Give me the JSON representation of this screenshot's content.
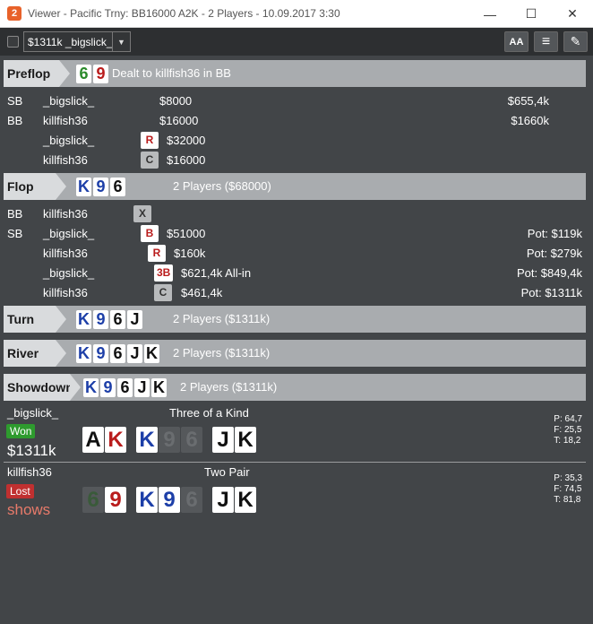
{
  "window": {
    "app_icon_text": "2",
    "title": "Viewer - Pacific Trny: BB16000 A2K - 2 Players - 10.09.2017 3:30",
    "minimize": "—",
    "maximize": "☐",
    "close": "✕"
  },
  "toolbar": {
    "player_select": "$1311k _bigslick_",
    "arrow": "▼",
    "font_btn": "AA",
    "list_btn": "≡",
    "edit_btn": "✎"
  },
  "preflop": {
    "label": "Preflop",
    "info": "Dealt to killfish36 in BB",
    "cards": [
      {
        "r": "6",
        "c": "green"
      },
      {
        "r": "9",
        "c": "red"
      }
    ],
    "rows": [
      {
        "pos": "SB",
        "player": "_bigslick_",
        "action": "",
        "amount": "$8000",
        "pot": "$655,4k"
      },
      {
        "pos": "BB",
        "player": "killfish36",
        "action": "",
        "amount": "$16000",
        "pot": "$1660k"
      },
      {
        "pos": "",
        "player": "_bigslick_",
        "action": "R",
        "amount": "$32000",
        "pot": ""
      },
      {
        "pos": "",
        "player": "killfish36",
        "action": "C",
        "amount": "$16000",
        "pot": ""
      }
    ]
  },
  "flop": {
    "label": "Flop",
    "info": "2 Players ($68000)",
    "cards": [
      {
        "r": "K",
        "c": "blue"
      },
      {
        "r": "9",
        "c": "blue"
      },
      {
        "r": "6",
        "c": "black"
      }
    ],
    "rows": [
      {
        "pos": "BB",
        "player": "killfish36",
        "action": "X",
        "amount": "",
        "pot": ""
      },
      {
        "pos": "SB",
        "player": "_bigslick_",
        "action": "B",
        "amount": "$51000",
        "pot": "Pot: $119k"
      },
      {
        "pos": "",
        "player": "killfish36",
        "action": "R",
        "amount": "$160k",
        "pot": "Pot: $279k"
      },
      {
        "pos": "",
        "player": "_bigslick_",
        "action": "3B",
        "amount": "$621,4k All-in",
        "pot": "Pot: $849,4k"
      },
      {
        "pos": "",
        "player": "killfish36",
        "action": "C",
        "amount": "$461,4k",
        "pot": "Pot: $1311k"
      }
    ]
  },
  "turn": {
    "label": "Turn",
    "info": "2 Players ($1311k)",
    "cards": [
      {
        "r": "K",
        "c": "blue"
      },
      {
        "r": "9",
        "c": "blue"
      },
      {
        "r": "6",
        "c": "black"
      },
      {
        "r": "J",
        "c": "black"
      }
    ]
  },
  "river": {
    "label": "River",
    "info": "2 Players ($1311k)",
    "cards": [
      {
        "r": "K",
        "c": "blue"
      },
      {
        "r": "9",
        "c": "blue"
      },
      {
        "r": "6",
        "c": "black"
      },
      {
        "r": "J",
        "c": "black"
      },
      {
        "r": "K",
        "c": "black"
      }
    ]
  },
  "showdown": {
    "label": "Showdown",
    "info": "2 Players ($1311k)",
    "cards": [
      {
        "r": "K",
        "c": "blue"
      },
      {
        "r": "9",
        "c": "blue"
      },
      {
        "r": "6",
        "c": "black"
      },
      {
        "r": "J",
        "c": "black"
      },
      {
        "r": "K",
        "c": "black"
      }
    ],
    "players": [
      {
        "name": "_bigslick_",
        "hand": "Three of a Kind",
        "result": "Won",
        "amount": "$1311k",
        "hole": [
          {
            "r": "A",
            "c": "black",
            "dim": false
          },
          {
            "r": "K",
            "c": "red",
            "dim": false
          }
        ],
        "board": [
          {
            "r": "K",
            "c": "blue",
            "dim": false
          },
          {
            "r": "9",
            "c": "blue",
            "dim": true
          },
          {
            "r": "6",
            "c": "black",
            "dim": true
          },
          {
            "r": "J",
            "c": "black",
            "dim": false
          },
          {
            "r": "K",
            "c": "black",
            "dim": false
          }
        ],
        "stats": [
          "P: 64,7",
          "F: 25,5",
          "T: 18,2"
        ]
      },
      {
        "name": "killfish36",
        "hand": "Two Pair",
        "result": "Lost",
        "amount": "shows",
        "hole": [
          {
            "r": "6",
            "c": "green",
            "dim": true
          },
          {
            "r": "9",
            "c": "red",
            "dim": false
          }
        ],
        "board": [
          {
            "r": "K",
            "c": "blue",
            "dim": false
          },
          {
            "r": "9",
            "c": "blue",
            "dim": false
          },
          {
            "r": "6",
            "c": "black",
            "dim": true
          },
          {
            "r": "J",
            "c": "black",
            "dim": false
          },
          {
            "r": "K",
            "c": "black",
            "dim": false
          }
        ],
        "stats": [
          "P: 35,3",
          "F: 74,5",
          "T: 81,8"
        ]
      }
    ]
  }
}
